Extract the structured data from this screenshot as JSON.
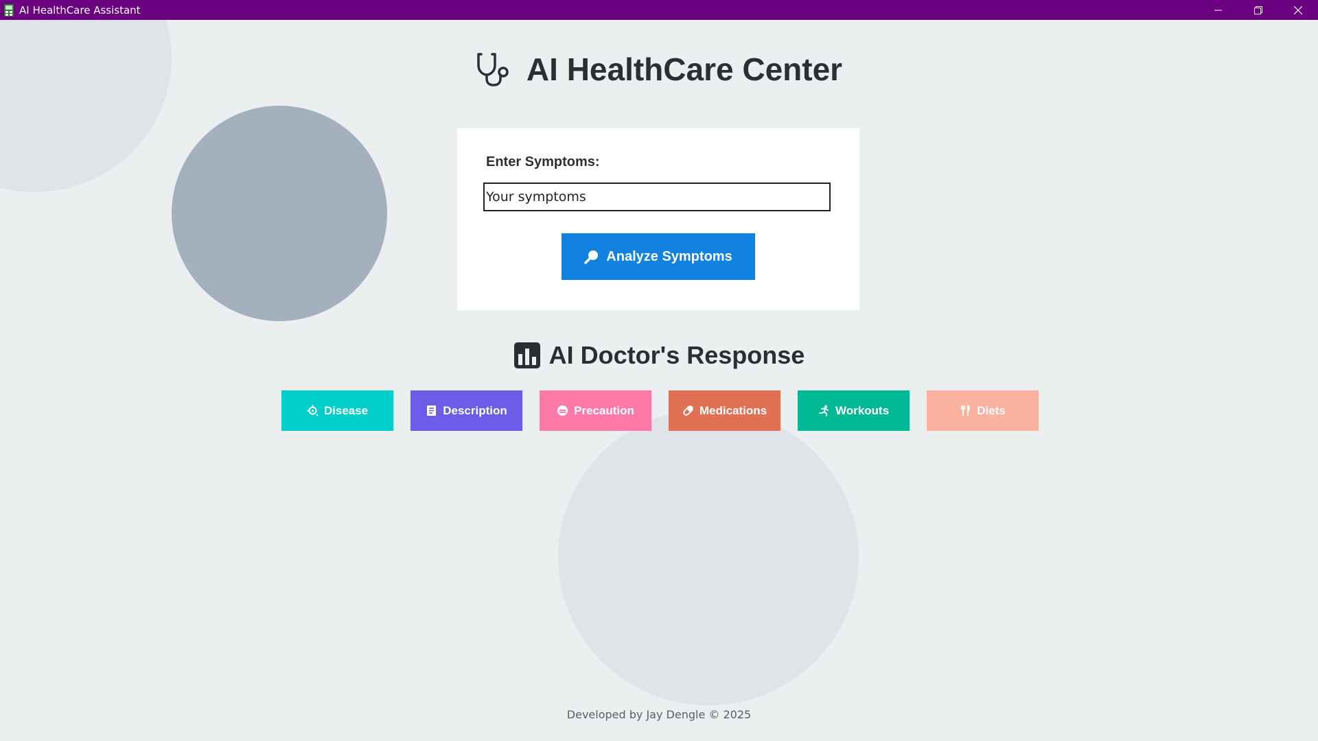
{
  "window": {
    "title": "AI HealthCare Assistant",
    "titlebar_color": "#6b0080",
    "controls": [
      "minimize-icon",
      "restore-icon",
      "close-icon"
    ]
  },
  "header": {
    "icon": "stethoscope-icon",
    "title": "AI HealthCare Center"
  },
  "form": {
    "label": "Enter Symptoms:",
    "input_value": "",
    "input_placeholder": "Your symptoms",
    "analyze_label": "Analyze Symptoms",
    "analyze_icon": "magnifier-icon",
    "analyze_color": "#1282e0"
  },
  "response": {
    "icon": "bar-chart-icon",
    "title": "AI Doctor's Response",
    "buttons": [
      {
        "label": "Disease",
        "icon": "virus-icon",
        "color": "#00cec9"
      },
      {
        "label": "Description",
        "icon": "document-icon",
        "color": "#6c5ce7"
      },
      {
        "label": "Precaution",
        "icon": "mask-icon",
        "color": "#fd79a8"
      },
      {
        "label": "Medications",
        "icon": "pill-icon",
        "color": "#e17055"
      },
      {
        "label": "Workouts",
        "icon": "running-icon",
        "color": "#00b894"
      },
      {
        "label": "Diets",
        "icon": "utensils-icon",
        "color": "#fab1a0"
      }
    ]
  },
  "footer": {
    "text": "Developed by Jay Dengle © 2025"
  }
}
